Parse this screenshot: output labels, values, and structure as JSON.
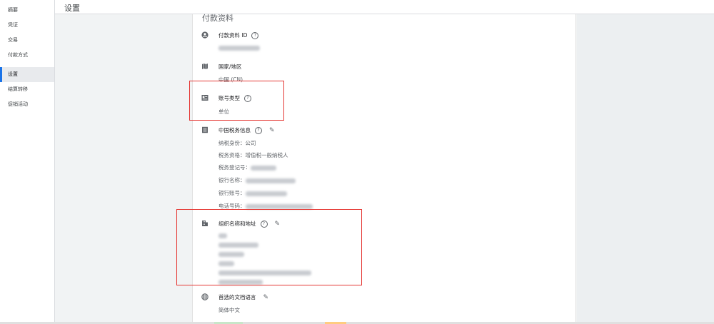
{
  "sidebar": {
    "items": [
      {
        "label": "摘要"
      },
      {
        "label": "凭证"
      },
      {
        "label": "交易"
      },
      {
        "label": "付款方式"
      },
      {
        "label": "设置"
      },
      {
        "label": "结算转移"
      },
      {
        "label": "促销活动"
      }
    ]
  },
  "header": {
    "title": "设置"
  },
  "section": {
    "title": "付款资料"
  },
  "profile_id": {
    "label": "付款资料 ID"
  },
  "country": {
    "label": "国家/地区",
    "value": "中国 (CN)"
  },
  "account_type": {
    "label": "账号类型",
    "value": "单位"
  },
  "tax": {
    "label": "中国税务信息",
    "lines": [
      "纳税身份：公司",
      "税务资格：增值税一般纳税人",
      "税务登记号：",
      "银行名称：",
      "银行账号：",
      "电话号码："
    ]
  },
  "org": {
    "label": "组织名称和地址"
  },
  "lang": {
    "label": "首选的文档语言",
    "value": "简体中文"
  },
  "colors": {
    "accent": "#1a73e8",
    "highlight": "#e53935"
  },
  "icons": {
    "profile": "account-circle-icon",
    "country": "map-icon",
    "account_type": "badge-icon",
    "tax": "document-icon",
    "org": "building-icon",
    "lang": "globe-icon",
    "help": "help-icon",
    "edit": "pencil-icon"
  }
}
